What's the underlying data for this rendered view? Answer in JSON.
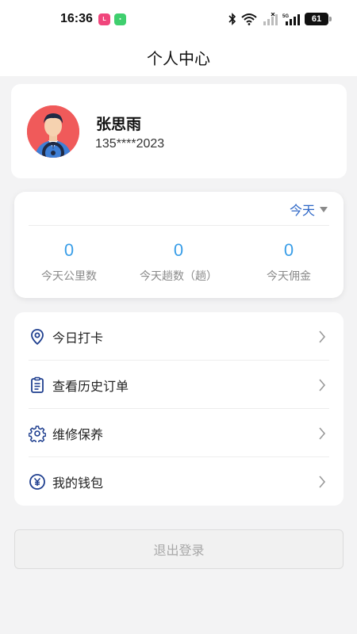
{
  "status_bar": {
    "time": "16:36",
    "badge1": "LALA",
    "battery": "61",
    "network": "5G"
  },
  "header": {
    "title": "个人中心"
  },
  "profile": {
    "name": "张思雨",
    "phone": "135****2023"
  },
  "stats": {
    "period": "今天",
    "items": [
      {
        "value": "0",
        "label": "今天公里数"
      },
      {
        "value": "0",
        "label": "今天趟数（趟）"
      },
      {
        "value": "0",
        "label": "今天佣金"
      }
    ]
  },
  "menu": {
    "items": [
      {
        "label": "今日打卡",
        "icon": "location-pin-icon"
      },
      {
        "label": "查看历史订单",
        "icon": "clipboard-list-icon"
      },
      {
        "label": "维修保养",
        "icon": "gear-icon"
      },
      {
        "label": "我的钱包",
        "icon": "yen-coin-icon"
      }
    ]
  },
  "logout": {
    "label": "退出登录"
  },
  "colors": {
    "accent_blue": "#2d66c6",
    "stat_value": "#3a9ee8",
    "avatar_bg": "#f05a5a",
    "page_bg": "#f3f3f4"
  }
}
